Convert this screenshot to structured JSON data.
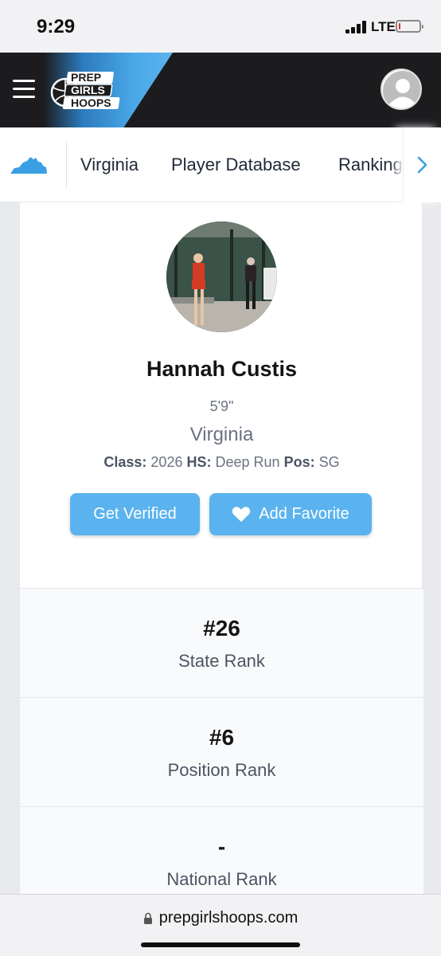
{
  "status_bar": {
    "time": "9:29",
    "network": "LTE",
    "battery_level": 0.08
  },
  "header": {
    "logo_lines": [
      "PREP",
      "GIRLS",
      "HOOPS"
    ],
    "menu_icon": "hamburger-icon",
    "account_icon": "user-avatar-icon",
    "accent_color": "#5ab3ee"
  },
  "subnav": {
    "state_icon": "virginia-map-icon",
    "items": [
      "Virginia",
      "Player Database",
      "Rankings"
    ],
    "scroll_icon": "chevron-right-icon"
  },
  "profile": {
    "name": "Hannah Custis",
    "height": "5'9\"",
    "state": "Virginia",
    "class_label": "Class:",
    "class_value": "2026",
    "hs_label": "HS:",
    "hs_value": "Deep Run",
    "pos_label": "Pos:",
    "pos_value": "SG",
    "get_verified_label": "Get Verified",
    "add_favorite_label": "Add Favorite",
    "favorite_icon": "heart-icon"
  },
  "ranks": [
    {
      "value": "#26",
      "label": "State Rank"
    },
    {
      "value": "#6",
      "label": "Position Rank"
    },
    {
      "value": "-",
      "label": "National Rank"
    }
  ],
  "browser": {
    "url": "prepgirlshoops.com",
    "lock_icon": "lock-icon"
  }
}
